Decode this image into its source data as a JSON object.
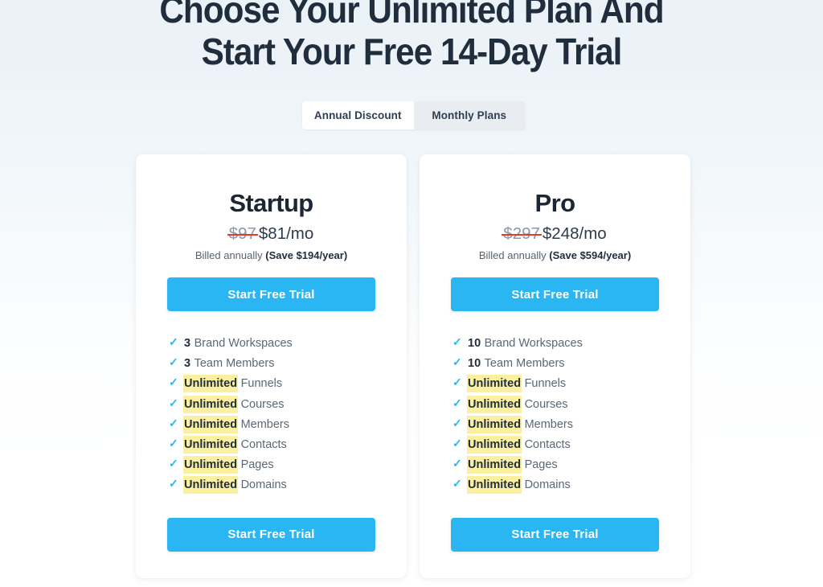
{
  "heading": {
    "line1": "Choose Your Unlimited Plan And",
    "line2": "Start Your Free 14-Day Trial"
  },
  "billing_toggle": {
    "annual_label": "Annual Discount",
    "monthly_label": "Monthly Plans",
    "selected": "Annual Discount"
  },
  "colors": {
    "accent_blue": "#29b6f2",
    "heading_navy": "#1f2d3d",
    "strikethrough_red": "#e8392c",
    "highlight_yellow": "#fbefa0",
    "page_background": "#eef4f9"
  },
  "icons": {
    "check": "✓"
  },
  "plans": [
    {
      "name": "Startup",
      "old_price": "$97",
      "new_price": "$81/mo",
      "billed_prefix": "Billed annually ",
      "billed_savings": "(Save $194/year)",
      "cta_top_label": "Start Free Trial",
      "cta_bottom_label": "Start Free Trial",
      "features": [
        {
          "qty": "3",
          "highlight": false,
          "label": "Brand Workspaces"
        },
        {
          "qty": "3",
          "highlight": false,
          "label": "Team Members"
        },
        {
          "qty": "Unlimited",
          "highlight": true,
          "label": "Funnels"
        },
        {
          "qty": "Unlimited",
          "highlight": true,
          "label": "Courses"
        },
        {
          "qty": "Unlimited",
          "highlight": true,
          "label": "Members"
        },
        {
          "qty": "Unlimited",
          "highlight": true,
          "label": "Contacts"
        },
        {
          "qty": "Unlimited",
          "highlight": true,
          "label": "Pages"
        },
        {
          "qty": "Unlimited",
          "highlight": true,
          "label": "Domains"
        }
      ]
    },
    {
      "name": "Pro",
      "old_price": "$297",
      "new_price": "$248/mo",
      "billed_prefix": "Billed annually ",
      "billed_savings": "(Save $594/year)",
      "cta_top_label": "Start Free Trial",
      "cta_bottom_label": "Start Free Trial",
      "features": [
        {
          "qty": "10",
          "highlight": false,
          "label": "Brand Workspaces"
        },
        {
          "qty": "10",
          "highlight": false,
          "label": "Team Members"
        },
        {
          "qty": "Unlimited",
          "highlight": true,
          "label": "Funnels"
        },
        {
          "qty": "Unlimited",
          "highlight": true,
          "label": "Courses"
        },
        {
          "qty": "Unlimited",
          "highlight": true,
          "label": "Members"
        },
        {
          "qty": "Unlimited",
          "highlight": true,
          "label": "Contacts"
        },
        {
          "qty": "Unlimited",
          "highlight": true,
          "label": "Pages"
        },
        {
          "qty": "Unlimited",
          "highlight": true,
          "label": "Domains"
        }
      ]
    }
  ]
}
